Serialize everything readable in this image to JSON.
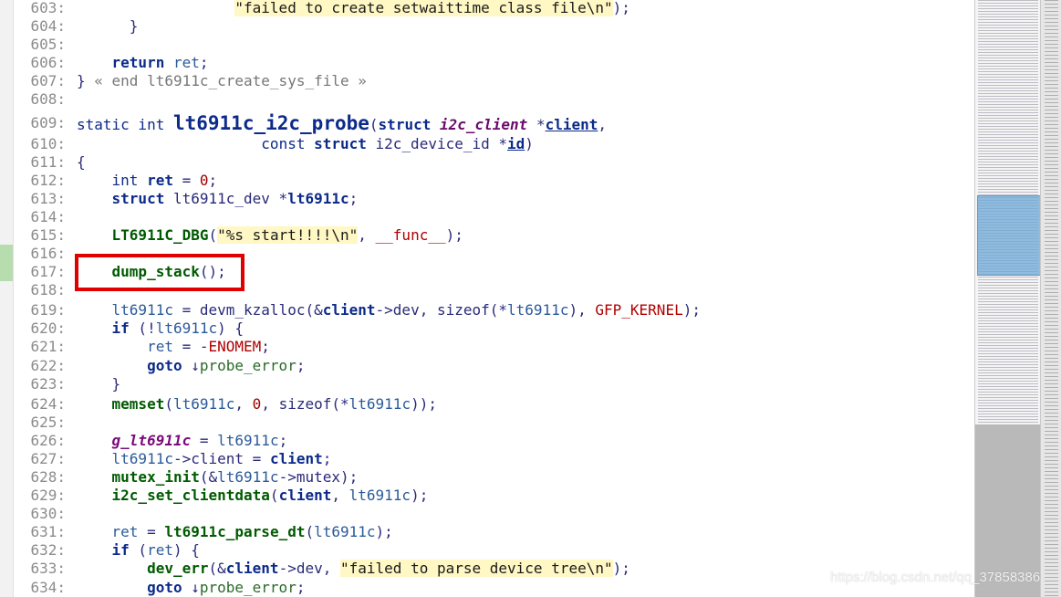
{
  "editor": {
    "lines": [
      {
        "n": "603:",
        "tokens": [
          [
            "s",
            "\"failed to create setwaittime class file\\n\""
          ],
          [
            "p",
            ");"
          ]
        ],
        "indent": "                  "
      },
      {
        "n": "604:",
        "tokens": [
          [
            "p",
            "}"
          ]
        ],
        "indent": "      "
      },
      {
        "n": "605:",
        "tokens": [],
        "indent": ""
      },
      {
        "n": "606:",
        "tokens": [
          [
            "k",
            "return"
          ],
          [
            "p",
            " "
          ],
          [
            "v",
            "ret"
          ],
          [
            "p",
            ";"
          ]
        ],
        "indent": "    "
      },
      {
        "n": "607:",
        "tokens": [
          [
            "p",
            "} "
          ],
          [
            "c",
            "« end lt6911c_create_sys_file »"
          ]
        ],
        "indent": ""
      },
      {
        "n": "608:",
        "tokens": [],
        "indent": ""
      },
      {
        "n": "609:",
        "tokens": [
          [
            "t",
            "static int "
          ],
          [
            "fd",
            "lt6911c_i2c_probe"
          ],
          [
            "p",
            "("
          ],
          [
            "k",
            "struct"
          ],
          [
            "p",
            " "
          ],
          [
            "pt",
            "i2c_client"
          ],
          [
            "p",
            " *"
          ],
          [
            "pr",
            "client"
          ],
          [
            "p",
            ","
          ]
        ],
        "indent": ""
      },
      {
        "n": "610:",
        "tokens": [
          [
            "t",
            "const "
          ],
          [
            "k",
            "struct"
          ],
          [
            "p",
            " i2c_device_id *"
          ],
          [
            "pr",
            "id"
          ],
          [
            "p",
            ")"
          ]
        ],
        "indent": "                     "
      },
      {
        "n": "611:",
        "tokens": [
          [
            "p",
            "{"
          ]
        ],
        "indent": ""
      },
      {
        "n": "612:",
        "tokens": [
          [
            "t",
            "int "
          ],
          [
            "lv",
            "ret"
          ],
          [
            "p",
            " = "
          ],
          [
            "num",
            "0"
          ],
          [
            "p",
            ";"
          ]
        ],
        "indent": "    "
      },
      {
        "n": "613:",
        "tokens": [
          [
            "k",
            "struct"
          ],
          [
            "p",
            " lt6911c_dev *"
          ],
          [
            "lv",
            "lt6911c"
          ],
          [
            "p",
            ";"
          ]
        ],
        "indent": "    "
      },
      {
        "n": "614:",
        "tokens": [],
        "indent": ""
      },
      {
        "n": "615:",
        "tokens": [
          [
            "f",
            "LT6911C_DBG"
          ],
          [
            "p",
            "("
          ],
          [
            "s",
            "\"%s start!!!!\\n\""
          ],
          [
            "p",
            ", "
          ],
          [
            "m",
            "__func__"
          ],
          [
            "p",
            ");"
          ]
        ],
        "indent": "    "
      },
      {
        "n": "616:",
        "tokens": [],
        "indent": ""
      },
      {
        "n": "617:",
        "tokens": [
          [
            "f",
            "dump_stack"
          ],
          [
            "p",
            "();"
          ]
        ],
        "indent": "    "
      },
      {
        "n": "618:",
        "tokens": [],
        "indent": ""
      },
      {
        "n": "619:",
        "tokens": [
          [
            "v",
            "lt6911c"
          ],
          [
            "p",
            " = devm_kzalloc(&"
          ],
          [
            "lv",
            "client"
          ],
          [
            "p",
            "->dev, sizeof(*"
          ],
          [
            "v",
            "lt6911c"
          ],
          [
            "p",
            "), "
          ],
          [
            "m",
            "GFP_KERNEL"
          ],
          [
            "p",
            ");"
          ]
        ],
        "indent": "    "
      },
      {
        "n": "620:",
        "tokens": [
          [
            "k",
            "if"
          ],
          [
            "p",
            " (!"
          ],
          [
            "v",
            "lt6911c"
          ],
          [
            "p",
            ") {"
          ]
        ],
        "indent": "    "
      },
      {
        "n": "621:",
        "tokens": [
          [
            "v",
            "ret"
          ],
          [
            "p",
            " = -"
          ],
          [
            "m",
            "ENOMEM"
          ],
          [
            "p",
            ";"
          ]
        ],
        "indent": "        "
      },
      {
        "n": "622:",
        "tokens": [
          [
            "k",
            "goto"
          ],
          [
            "p",
            " ↓"
          ],
          [
            "l",
            "probe_error"
          ],
          [
            "p",
            ";"
          ]
        ],
        "indent": "        "
      },
      {
        "n": "623:",
        "tokens": [
          [
            "p",
            "}"
          ]
        ],
        "indent": "    "
      },
      {
        "n": "624:",
        "tokens": [
          [
            "f",
            "memset"
          ],
          [
            "p",
            "("
          ],
          [
            "v",
            "lt6911c"
          ],
          [
            "p",
            ", "
          ],
          [
            "num",
            "0"
          ],
          [
            "p",
            ", sizeof(*"
          ],
          [
            "v",
            "lt6911c"
          ],
          [
            "p",
            "));"
          ]
        ],
        "indent": "    "
      },
      {
        "n": "625:",
        "tokens": [],
        "indent": ""
      },
      {
        "n": "626:",
        "tokens": [
          [
            "g",
            "g_lt6911c"
          ],
          [
            "p",
            " = "
          ],
          [
            "v",
            "lt6911c"
          ],
          [
            "p",
            ";"
          ]
        ],
        "indent": "    "
      },
      {
        "n": "627:",
        "tokens": [
          [
            "v",
            "lt6911c"
          ],
          [
            "p",
            "->client = "
          ],
          [
            "lv",
            "client"
          ],
          [
            "p",
            ";"
          ]
        ],
        "indent": "    "
      },
      {
        "n": "628:",
        "tokens": [
          [
            "f",
            "mutex_init"
          ],
          [
            "p",
            "(&"
          ],
          [
            "v",
            "lt6911c"
          ],
          [
            "p",
            "->mutex);"
          ]
        ],
        "indent": "    "
      },
      {
        "n": "629:",
        "tokens": [
          [
            "f",
            "i2c_set_clientdata"
          ],
          [
            "p",
            "("
          ],
          [
            "lv",
            "client"
          ],
          [
            "p",
            ", "
          ],
          [
            "v",
            "lt6911c"
          ],
          [
            "p",
            ");"
          ]
        ],
        "indent": "    "
      },
      {
        "n": "630:",
        "tokens": [],
        "indent": ""
      },
      {
        "n": "631:",
        "tokens": [
          [
            "v",
            "ret"
          ],
          [
            "p",
            " = "
          ],
          [
            "f",
            "lt6911c_parse_dt"
          ],
          [
            "p",
            "("
          ],
          [
            "v",
            "lt6911c"
          ],
          [
            "p",
            ");"
          ]
        ],
        "indent": "    "
      },
      {
        "n": "632:",
        "tokens": [
          [
            "k",
            "if"
          ],
          [
            "p",
            " ("
          ],
          [
            "v",
            "ret"
          ],
          [
            "p",
            ") {"
          ]
        ],
        "indent": "    "
      },
      {
        "n": "633:",
        "tokens": [
          [
            "f",
            "dev_err"
          ],
          [
            "p",
            "(&"
          ],
          [
            "lv",
            "client"
          ],
          [
            "p",
            "->dev, "
          ],
          [
            "s",
            "\"failed to parse device tree\\n\""
          ],
          [
            "p",
            ");"
          ]
        ],
        "indent": "        "
      },
      {
        "n": "634:",
        "tokens": [
          [
            "k",
            "goto"
          ],
          [
            "p",
            " ↓"
          ],
          [
            "l",
            "probe_error"
          ],
          [
            "p",
            ";"
          ]
        ],
        "indent": "        "
      }
    ]
  },
  "watermark": {
    "text": "https://blog.csdn.net/qq_37858386"
  },
  "colors": {
    "highlight_box": "#e00000",
    "minimap_viewport": "#6eaad7",
    "string_bg": "#fff7c4"
  }
}
